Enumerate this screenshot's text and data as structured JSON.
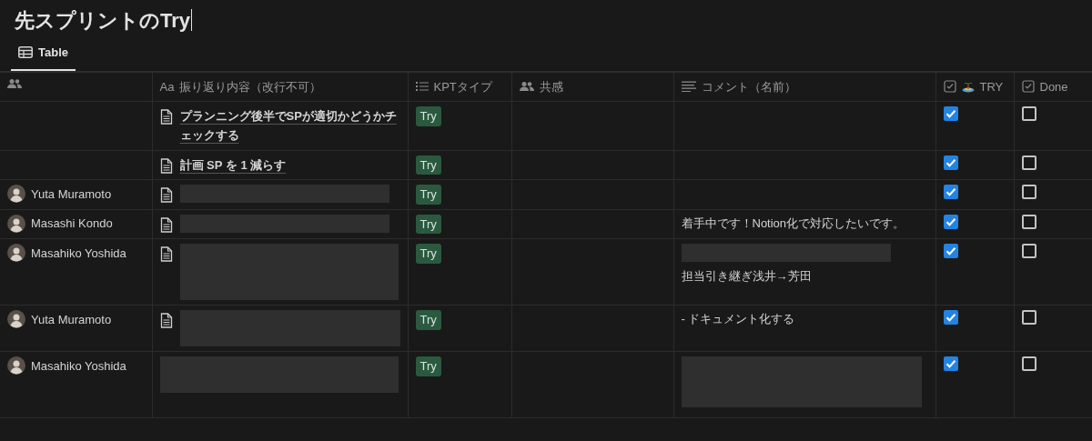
{
  "page_title": "先スプリントのTry",
  "views": [
    {
      "label": "Table",
      "selected": true
    }
  ],
  "columns": [
    {
      "kind": "person"
    },
    {
      "kind": "title",
      "label": "振り返り内容（改行不可）",
      "prefix": "Aa"
    },
    {
      "kind": "select",
      "label": "KPTタイプ"
    },
    {
      "kind": "person",
      "label": "共感"
    },
    {
      "kind": "text",
      "label": "コメント（名前）"
    },
    {
      "kind": "emoji-checkbox",
      "label": "TRY"
    },
    {
      "kind": "checkbox",
      "label": "Done"
    }
  ],
  "rows": [
    {
      "person": null,
      "content": {
        "page_icon": true,
        "parts": [
          {
            "kind": "text",
            "text": "プランニング後半でSPが適切かどうかチェックする"
          }
        ]
      },
      "kpt": "Try",
      "comment": [],
      "try": true,
      "done": false
    },
    {
      "person": null,
      "content": {
        "page_icon": true,
        "parts": [
          {
            "kind": "text",
            "text": "計画 SP を 1 減らす"
          }
        ]
      },
      "kpt": "Try",
      "comment": [],
      "try": true,
      "done": false
    },
    {
      "person": "Yuta Muramoto",
      "content": {
        "page_icon": true,
        "parts": [
          {
            "kind": "redacted-line"
          }
        ]
      },
      "kpt": "Try",
      "comment": [],
      "try": true,
      "done": false
    },
    {
      "person": "Masashi Kondo",
      "content": {
        "page_icon": true,
        "parts": [
          {
            "kind": "redacted-line"
          }
        ]
      },
      "kpt": "Try",
      "comment": [
        {
          "kind": "text",
          "text": "着手中です！Notion化で対応したいです。"
        }
      ],
      "try": true,
      "done": false
    },
    {
      "person": "Masahiko Yoshida",
      "content": {
        "page_icon": true,
        "parts": [
          {
            "kind": "redacted-tall"
          }
        ]
      },
      "kpt": "Try",
      "comment": [
        {
          "kind": "redacted-line"
        },
        {
          "kind": "text",
          "text": "担当引き継ぎ浅井→芳田"
        }
      ],
      "try": true,
      "done": false
    },
    {
      "person": "Yuta Muramoto",
      "content": {
        "page_icon": true,
        "parts": [
          {
            "kind": "redacted-medium"
          }
        ]
      },
      "kpt": "Try",
      "comment": [
        {
          "kind": "text",
          "text": "- ドキュメント化する"
        }
      ],
      "try": true,
      "done": false
    },
    {
      "person": "Masahiko Yoshida",
      "content": {
        "page_icon": false,
        "parts": [
          {
            "kind": "redacted-medium"
          }
        ]
      },
      "kpt": "Try",
      "comment": [
        {
          "kind": "redacted-large"
        }
      ],
      "try": true,
      "done": false
    }
  ]
}
